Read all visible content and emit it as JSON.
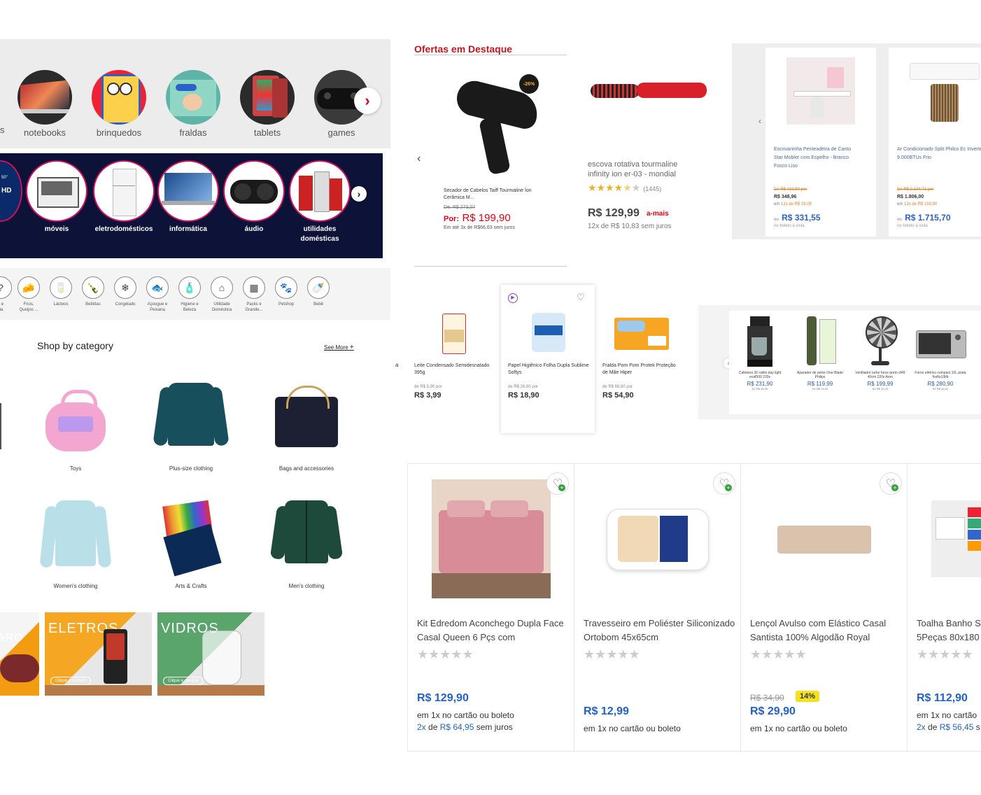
{
  "round_categories": {
    "left_partial": "s",
    "items": [
      "notebooks",
      "brinquedos",
      "fraldas",
      "tablets",
      "games"
    ]
  },
  "dark_categories": {
    "items": [
      "móveis",
      "eletrodomésticos",
      "informática",
      "áudio",
      "utilidades domésticas"
    ],
    "partial_hd": "HD",
    "partial_50": "50\""
  },
  "icon_categories": [
    {
      "label": "a e\nria",
      "icon": "?"
    },
    {
      "label": "Frios,\nQueijos ...",
      "icon": "🧀"
    },
    {
      "label": "Lácteos",
      "icon": "🥛"
    },
    {
      "label": "Bebidas",
      "icon": "🍾"
    },
    {
      "label": "Congelado",
      "icon": "❄"
    },
    {
      "label": "Açougue e\nPeixaria",
      "icon": "🐟"
    },
    {
      "label": "Higiene e\nBeleza",
      "icon": "🧴"
    },
    {
      "label": "Utilidade\nDoméstica",
      "icon": "⌂"
    },
    {
      "label": "Packs e\nGrande...",
      "icon": "▦"
    },
    {
      "label": "Petshop",
      "icon": "🐾"
    },
    {
      "label": "Bebê",
      "icon": "🍼"
    }
  ],
  "shop_by_category": {
    "title": "Shop by category",
    "see_more": "See More",
    "plus": "+",
    "items": [
      "Toys",
      "Plus-size clothing",
      "Bags and accessories",
      "Women's clothing",
      "Arts & Crafts",
      "Men's clothing"
    ]
  },
  "banners": [
    {
      "title": "ARO",
      "button": ""
    },
    {
      "title": "ELETROS",
      "button": "Clique e compre"
    },
    {
      "title": "VIDROS",
      "button": "Clique e compre"
    }
  ],
  "ofertas": {
    "title": "Ofertas em Destaque",
    "discount": "-26%",
    "product1": {
      "name": "Secador de Cabelos Taiff Tourmaline Íon Cerâmica M...",
      "old": "De: R$ 273,07",
      "por_label": "Por:",
      "price": "R$ 199,90",
      "inst": "Em até 3x de R$66,63 sem juros"
    },
    "product2": {
      "name": "escova rotativa tourmaline infinity ion er-03 - mondial",
      "stars": "★★★★",
      "half": "★",
      "rest": "★",
      "reviews": "(1445)",
      "price": "R$ 129,99",
      "badge": "a-mais",
      "inst": "12x de R$ 10,83 sem juros"
    }
  },
  "grey_cards": [
    {
      "name": "Escrivaninha Penteadeira de Canto Star Mobler com Espelho - Branco Fosco Liso",
      "old": "De R$ 410,50 por",
      "price": "R$ 348,96",
      "inst_a": "em ",
      "inst_b": "12x de R$ 29,08",
      "ou": "ou",
      "boleto_price": "R$ 331,55",
      "boleto": "no boleto à vista"
    },
    {
      "name": "Ar Condicionado Split Philco Ec Inverter 9.000BTUs Frio",
      "old": "De R$ 2.124,71 por",
      "price": "R$ 1.806,00",
      "inst_a": "em ",
      "inst_b": "12x de R$ 150,50",
      "ou": "ou",
      "boleto_price": "R$ 1.715,70",
      "boleto": "no boleto à vista"
    }
  ],
  "supermarket": {
    "left_char": "a",
    "items": [
      {
        "name": "Leite Condensado Semidesnatado 395g",
        "old": "de R$ 5,90 por",
        "price": "R$ 3,99"
      },
      {
        "name": "Papel Higiênico Folha Dupla Sublime Softys",
        "old": "de R$ 26,90 por",
        "price": "R$ 18,90"
      },
      {
        "name": "Fralda Pom Pom Protek Proteção de Mãe Hiper",
        "old": "de R$ 69,90 por",
        "price": "R$ 54,90"
      }
    ]
  },
  "small_products": [
    {
      "name": "Cafeteira 36 cafés day light ecaf500 220v",
      "price": "R$ 231,90",
      "sub": "6X R$ 38,65"
    },
    {
      "name": "Aparador de pelos One Blade Philips",
      "price": "R$ 119,99",
      "sub": "5X R$ 23,99"
    },
    {
      "name": "Ventilador turbo force preto vf49 40cm 220v Arno",
      "price": "R$ 199,99",
      "sub": "6X R$ 33,33"
    },
    {
      "name": "Forno elétrico compact 10L prata fosfto10ltb",
      "price": "R$ 280,90",
      "sub": "6X R$ 46,81"
    }
  ],
  "bottom_products": [
    {
      "name": "Kit Edredom Aconchego Dupla Face Casal Queen 6 Pçs com",
      "stars": "★★★★★",
      "old": "",
      "discount": "",
      "price": "R$ 129,90",
      "inst1": "em 1x no cartão ou boleto",
      "inst2a": "2x",
      "inst2b": " de ",
      "inst2c": "R$ 64,95",
      "inst2d": " sem juros"
    },
    {
      "name": "Travesseiro em Poliéster Siliconizado Ortobom 45x65cm",
      "stars": "★★★★★",
      "old": "",
      "discount": "",
      "price": "R$ 12,99",
      "inst1": "em 1x no cartão ou boleto",
      "inst2a": "",
      "inst2b": "",
      "inst2c": "",
      "inst2d": ""
    },
    {
      "name": "Lençol Avulso com Elástico Casal Santista 100% Algodão Royal",
      "stars": "★★★★★",
      "old": "R$ 34,90",
      "discount": "14%",
      "price": "R$ 29,90",
      "inst1": "em 1x no cartão ou boleto",
      "inst2a": "",
      "inst2b": "",
      "inst2c": "",
      "inst2d": ""
    },
    {
      "name": "Toalha Banho S 5Peças 80x180",
      "stars": "★★★★★",
      "old": "",
      "discount": "",
      "price": "R$ 112,90",
      "inst1": "em 1x no cartão",
      "inst2a": "2x",
      "inst2b": " de ",
      "inst2c": "R$ 56,45",
      "inst2d": " s"
    }
  ]
}
